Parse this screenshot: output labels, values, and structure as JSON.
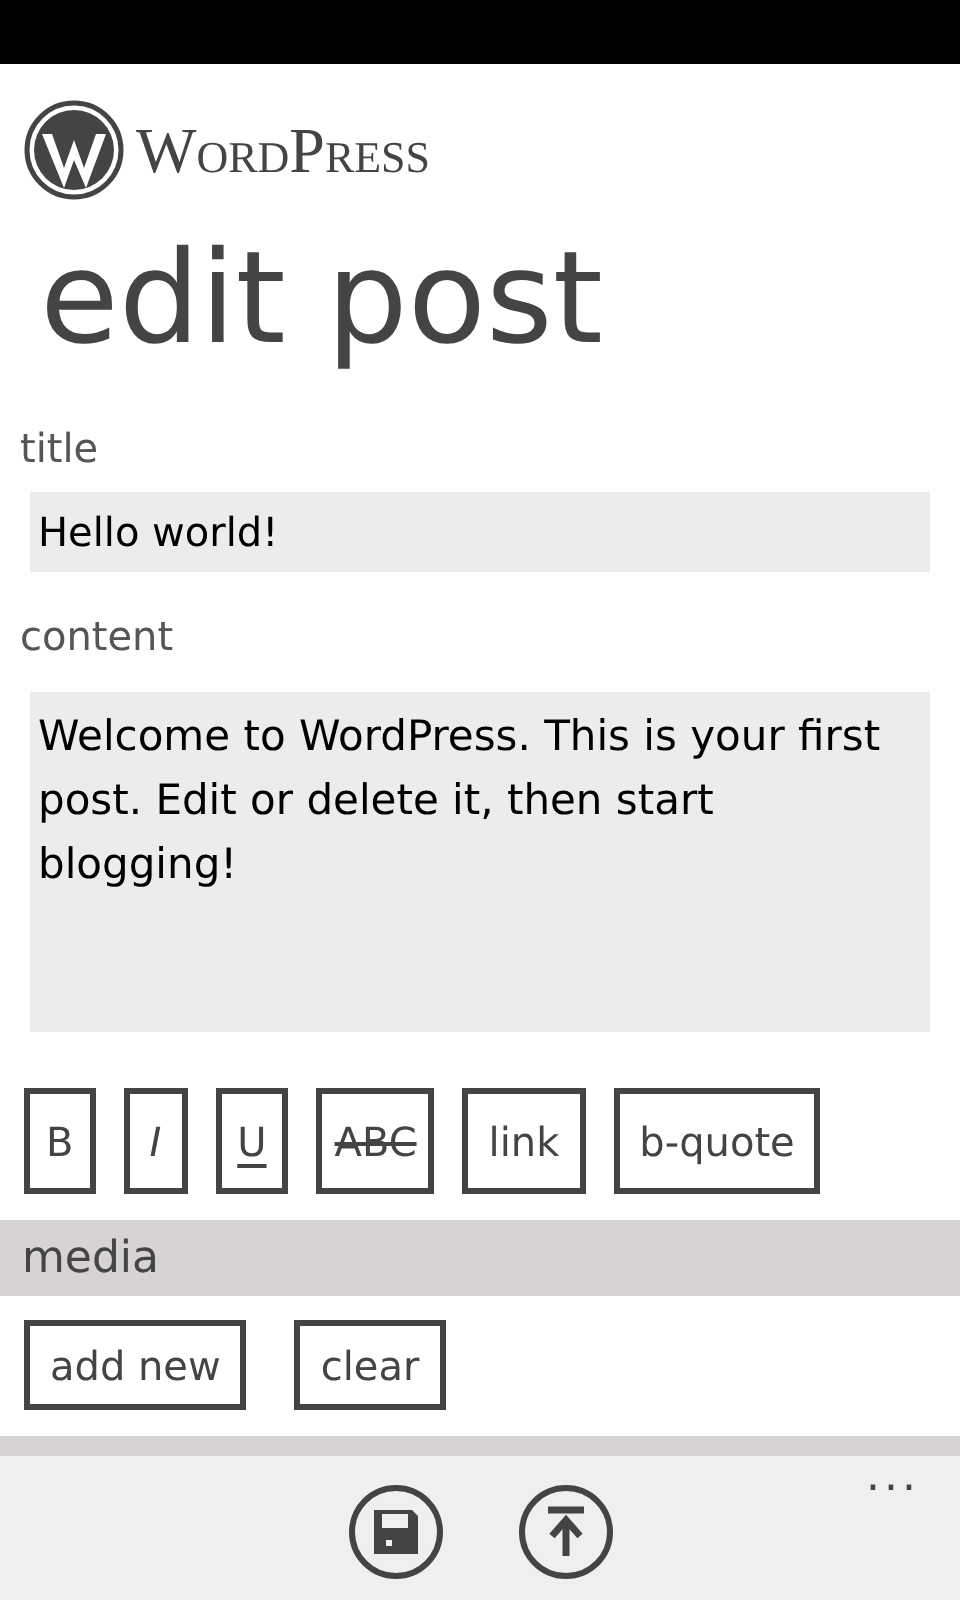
{
  "app": {
    "logo_text": "WordPress"
  },
  "page_title": "edit post",
  "title_field": {
    "label": "title",
    "value": "Hello world!"
  },
  "content_field": {
    "label": "content",
    "value": "Welcome to WordPress. This is your first post. Edit or delete it, then start blogging!"
  },
  "format_buttons": [
    {
      "label": "B",
      "kind": "bold"
    },
    {
      "label": "I",
      "kind": "italic"
    },
    {
      "label": "U",
      "kind": "underline"
    },
    {
      "label": "ABC",
      "kind": "strike"
    },
    {
      "label": "link",
      "kind": "plain"
    },
    {
      "label": "b-quote",
      "kind": "plain"
    }
  ],
  "media": {
    "header": "media",
    "buttons": [
      "add new",
      "clear"
    ]
  },
  "app_bar": {
    "buttons": [
      {
        "kind": "save"
      },
      {
        "kind": "publish"
      }
    ],
    "more": "..."
  }
}
